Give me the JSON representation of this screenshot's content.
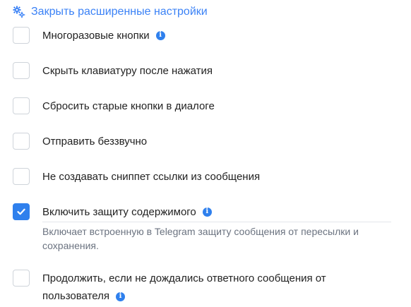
{
  "advanced": {
    "toggle_label": "Закрыть расширенные настройки"
  },
  "options": [
    {
      "label": "Многоразовые кнопки",
      "checked": false,
      "has_info": true
    },
    {
      "label": "Скрыть клавиатуру после нажатия",
      "checked": false,
      "has_info": false
    },
    {
      "label": "Сбросить старые кнопки в диалоге",
      "checked": false,
      "has_info": false
    },
    {
      "label": "Отправить беззвучно",
      "checked": false,
      "has_info": false
    },
    {
      "label": "Не создавать сниппет ссылки из сообщения",
      "checked": false,
      "has_info": false
    },
    {
      "label": "Включить защиту содержимого",
      "checked": true,
      "has_info": true,
      "description": "Включает встроенную в Telegram защиту сообщения от пересылки и сохранения."
    },
    {
      "label_line1": "Продолжить, если не дождались ответного сообщения от",
      "label_line2": "пользователя",
      "checked": false,
      "has_info": true
    }
  ],
  "icons": {
    "info": "i"
  },
  "colors": {
    "accent": "#2f80ed",
    "link": "#3b82f6",
    "text": "#222222",
    "muted": "#6b7380"
  }
}
